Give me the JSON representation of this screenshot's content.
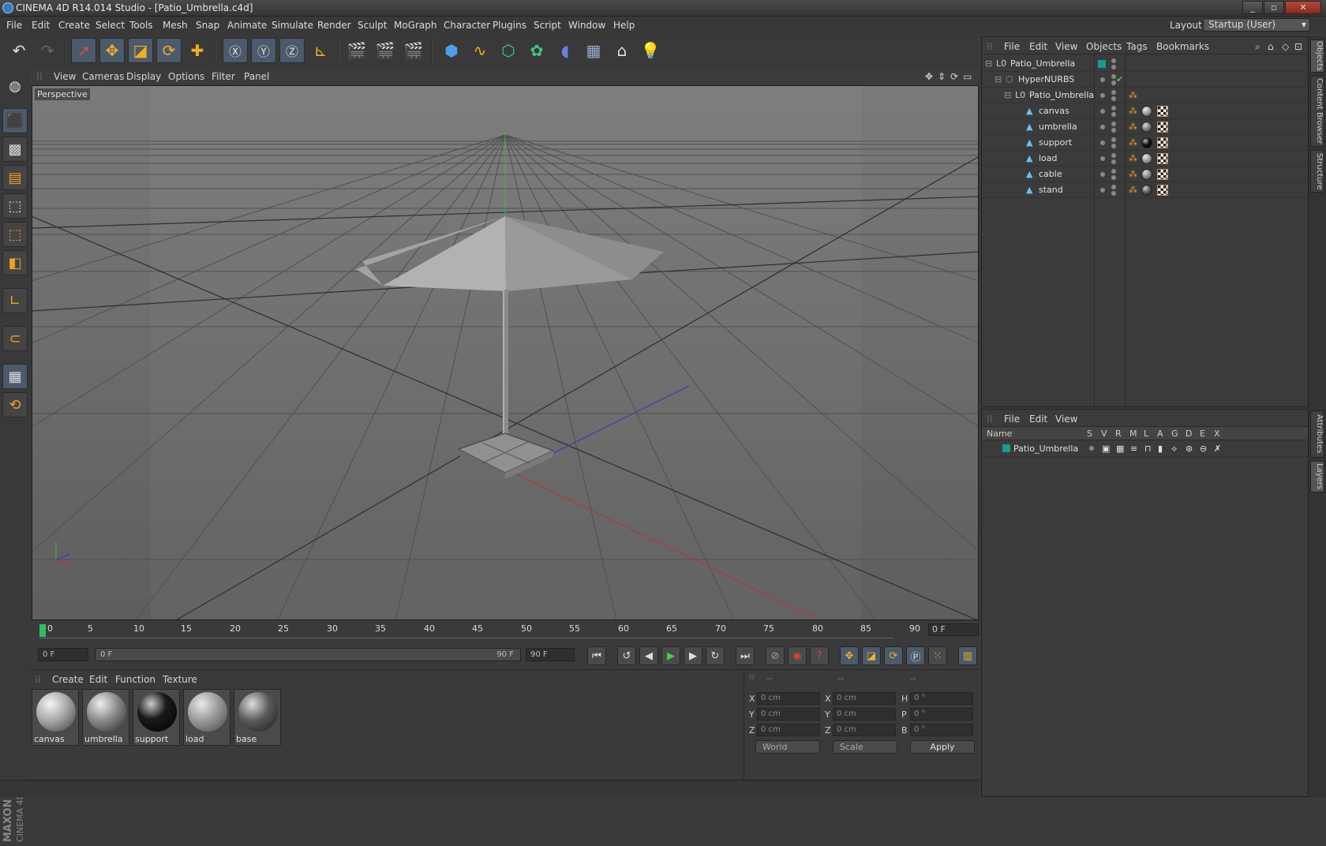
{
  "window": {
    "title": "CINEMA 4D R14.014 Studio - [Patio_Umbrella.c4d]",
    "buttons": [
      "_",
      "▫",
      "✕"
    ]
  },
  "menubar": [
    "File",
    "Edit",
    "Create",
    "Select",
    "Tools",
    "Mesh",
    "Snap",
    "Animate",
    "Simulate",
    "Render",
    "Sculpt",
    "MoGraph",
    "Character",
    "Plugins",
    "Script",
    "Window",
    "Help"
  ],
  "layout": {
    "label": "Layout:",
    "value": "Startup (User)"
  },
  "viewport": {
    "menu": [
      "View",
      "Cameras",
      "Display",
      "Options",
      "Filter",
      "Panel"
    ],
    "label": "Perspective"
  },
  "timeline": {
    "ticks": [
      "0",
      "5",
      "10",
      "15",
      "20",
      "25",
      "30",
      "35",
      "40",
      "45",
      "50",
      "55",
      "60",
      "65",
      "70",
      "75",
      "80",
      "85",
      "90"
    ],
    "current_frame": "0 F"
  },
  "playback": {
    "start": "0 F",
    "range_start": "0 F",
    "range_end": "90 F",
    "end": "90 F"
  },
  "materials": {
    "menu": [
      "Create",
      "Edit",
      "Function",
      "Texture"
    ],
    "items": [
      {
        "name": "canvas",
        "color": "#a8a8a8"
      },
      {
        "name": "umbrella",
        "color": "#8a8a8a"
      },
      {
        "name": "support",
        "color": "#1a1a1a"
      },
      {
        "name": "load",
        "color": "#9a9a9a"
      },
      {
        "name": "base",
        "color": "#5a5a5a"
      }
    ]
  },
  "coords": {
    "headers": [
      "--",
      "--",
      "--"
    ],
    "rows": [
      {
        "a": "X",
        "av": "0 cm",
        "b": "X",
        "bv": "0 cm",
        "c": "H",
        "cv": "0 °"
      },
      {
        "a": "Y",
        "av": "0 cm",
        "b": "Y",
        "bv": "0 cm",
        "c": "P",
        "cv": "0 °"
      },
      {
        "a": "Z",
        "av": "0 cm",
        "b": "Z",
        "bv": "0 cm",
        "c": "B",
        "cv": "0 °"
      }
    ],
    "space": "World",
    "mode": "Scale",
    "apply": "Apply"
  },
  "objects": {
    "menu": [
      "File",
      "Edit",
      "View",
      "Objects",
      "Tags",
      "Bookmarks"
    ],
    "tree": [
      {
        "name": "Patio_Umbrella",
        "depth": 0
      },
      {
        "name": "HyperNURBS",
        "depth": 1
      },
      {
        "name": "Patio_Umbrella",
        "depth": 2
      },
      {
        "name": "canvas",
        "depth": 3
      },
      {
        "name": "umbrella",
        "depth": 3
      },
      {
        "name": "support",
        "depth": 3
      },
      {
        "name": "load",
        "depth": 3
      },
      {
        "name": "cable",
        "depth": 3
      },
      {
        "name": "stand",
        "depth": 3
      }
    ]
  },
  "layers": {
    "menu": [
      "File",
      "Edit",
      "View"
    ],
    "columns": [
      "Name",
      "S",
      "V",
      "R",
      "M",
      "L",
      "A",
      "G",
      "D",
      "E",
      "X"
    ],
    "rows": [
      {
        "name": "Patio_Umbrella",
        "color": "#1a9a8a"
      }
    ]
  },
  "side_tabs": [
    "Objects",
    "Content Browser",
    "Structure",
    "Attributes",
    "Layers"
  ],
  "branding": {
    "maxon": "MAXON",
    "c4d": "CINEMA 4D"
  },
  "colors": {
    "accent": "#4b5a6c",
    "x_axis": "#c83232",
    "y_axis": "#32c832",
    "z_axis": "#3232c8"
  }
}
